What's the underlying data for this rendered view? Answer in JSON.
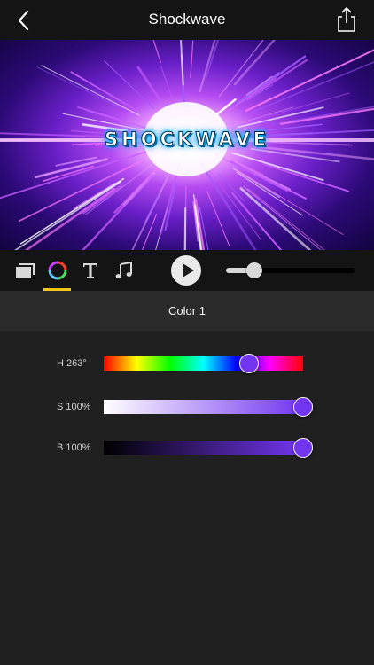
{
  "header": {
    "title": "Shockwave"
  },
  "preview": {
    "overlay_text": "SHOCKWAVE"
  },
  "toolbar": {
    "tabs": [
      "layers",
      "color",
      "text",
      "music"
    ],
    "active_tab": "color",
    "timeline_progress": 0.22
  },
  "section": {
    "title": "Color 1"
  },
  "color": {
    "hue_label": "H 263°",
    "hue_value": 263,
    "saturation_label": "S 100%",
    "saturation_value": 100,
    "brightness_label": "B 100%",
    "brightness_value": 100,
    "current_hex": "#7336F0"
  },
  "colors": {
    "active_tab_indicator": "#F5C518",
    "nav_background": "#141414",
    "panel_background": "#202020"
  }
}
